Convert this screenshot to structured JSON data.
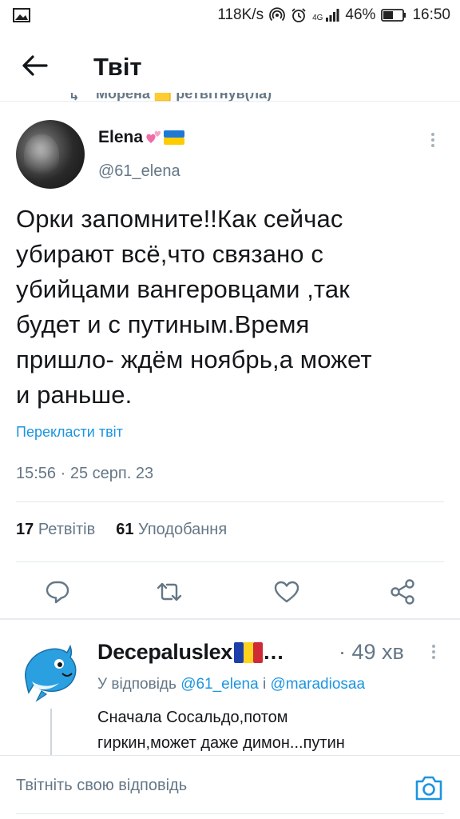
{
  "status_bar": {
    "speed": "118K/s",
    "network": "4G",
    "battery": "46%",
    "time": "16:50"
  },
  "header": {
    "title": "Твіт"
  },
  "retweet": {
    "text": "Морена 🟨 ретвітнув(ла)"
  },
  "tweet": {
    "author_name": "Elena",
    "author_emoji": "💞🇺🇦",
    "handle": "@61_elena",
    "text_lines": [
      "Орки запомните!!Как сейчас",
      "убирают всё,что связано с",
      "убийцами вангеровцами ,так",
      "будет и с путиным.Время",
      "пришло- ждём ноябрь,а может",
      "и раньше."
    ],
    "translate_label": "Перекласти твіт",
    "timestamp": "15:56 · 25 серп. 23",
    "retweets_count": "17",
    "retweets_label": "Ретвітів",
    "likes_count": "61",
    "likes_label": "Уподобання"
  },
  "reply": {
    "author_name": "Decepaluslex",
    "author_suffix": "…",
    "time": "· 49 хв",
    "reply_prefix": "У відповідь",
    "mention_1": "@61_elena",
    "joiner": "і",
    "mention_2": "@maradiosaa",
    "text_lines": [
      "Сначала Сосальдо,потом",
      "гиркин,может даже димон...путин"
    ]
  },
  "compose": {
    "placeholder": "Твітніть свою відповідь"
  },
  "colors": {
    "link_blue": "#1b95e0",
    "secondary_gray": "#657786",
    "text_dark": "#14171a"
  },
  "icons": [
    "image-icon",
    "hotspot-icon",
    "alarm-icon",
    "signal-icon",
    "battery-icon",
    "back-arrow-icon",
    "retweet-icon",
    "more-vertical-icon",
    "reply-icon",
    "retweet-action-icon",
    "like-icon",
    "share-icon",
    "camera-icon"
  ]
}
